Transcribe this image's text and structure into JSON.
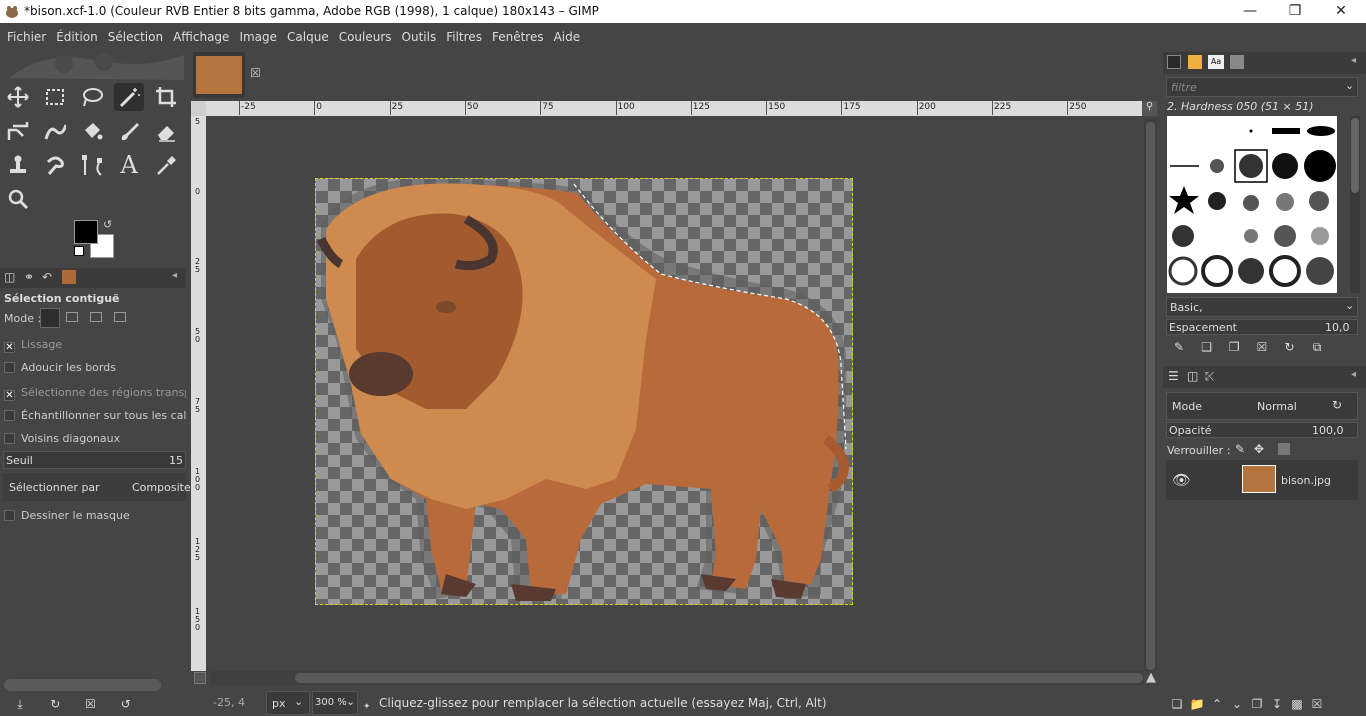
{
  "window": {
    "title": "*bison.xcf-1.0 (Couleur RVB Entier 8 bits gamma, Adobe RGB (1998), 1 calque) 180x143 – GIMP"
  },
  "menu": [
    "Fichier",
    "Édition",
    "Sélection",
    "Affichage",
    "Image",
    "Calque",
    "Couleurs",
    "Outils",
    "Filtres",
    "Fenêtres",
    "Aide"
  ],
  "tool_options": {
    "title": "Sélection contiguë",
    "mode_label": "Mode :",
    "options": [
      {
        "label": "Lissage",
        "checked": true,
        "dim": true
      },
      {
        "label": "Adoucir les bords",
        "checked": false,
        "dim": false
      },
      {
        "label": "Sélectionne des régions transpare",
        "checked": true,
        "dim": true
      },
      {
        "label": "Échantillonner sur tous les calque",
        "checked": false,
        "dim": false
      },
      {
        "label": "Voisins diagonaux",
        "checked": false,
        "dim": false
      }
    ],
    "threshold_label": "Seuil",
    "threshold_value": "15",
    "select_by_label": "Sélectionner par",
    "select_by_value": "Composite",
    "draw_mask_label": "Dessiner le masque"
  },
  "ruler": {
    "h_labels": [
      "-25",
      "0",
      "25",
      "50",
      "75",
      "100",
      "125",
      "150",
      "175",
      "200",
      "225",
      "250"
    ],
    "v_labels": [
      "5",
      "0",
      "2 5",
      "5 0",
      "7 5",
      "1 0 0",
      "1 2 5",
      "1 5 0"
    ]
  },
  "status": {
    "coords": "-25, 4",
    "unit": "px",
    "zoom": "300 %",
    "message": "Cliquez-glissez pour remplacer la sélection actuelle (essayez Maj, Ctrl, Alt)"
  },
  "brushes": {
    "filter_placeholder": "filtre",
    "current_brush": "2. Hardness 050 (51 × 51)",
    "preset": "Basic,",
    "spacing_label": "Espacement",
    "spacing_value": "10,0"
  },
  "layers": {
    "mode_label": "Mode",
    "mode_value": "Normal",
    "opacity_label": "Opacité",
    "opacity_value": "100,0",
    "lock_label": "Verrouiller :",
    "items": [
      {
        "name": "bison.jpg",
        "visible": true
      }
    ]
  },
  "colors": {
    "accent": "#e0d000",
    "fg": "#000000",
    "bg": "#ffffff"
  }
}
